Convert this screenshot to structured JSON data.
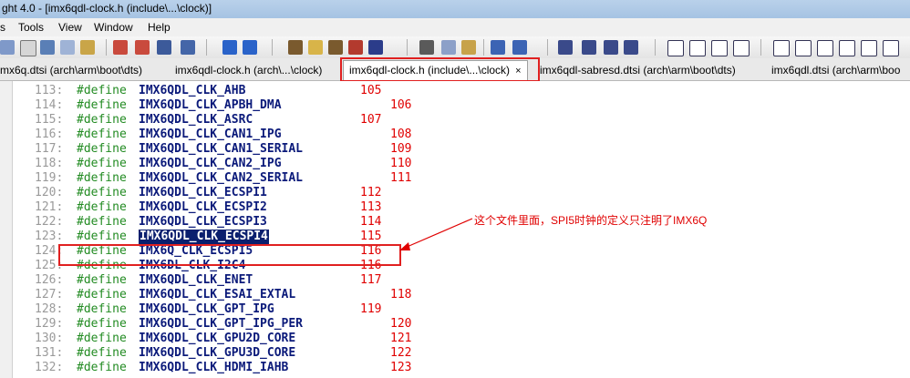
{
  "window": {
    "title": "ght 4.0 - [imx6qdl-clock.h (include\\...\\clock)]"
  },
  "menu": [
    "s",
    "Tools",
    "View",
    "Window",
    "Help"
  ],
  "tabs": [
    {
      "label": "mx6q.dtsi (arch\\arm\\boot\\dts)"
    },
    {
      "label": "imx6qdl-clock.h (arch\\...\\clock)"
    },
    {
      "label": "imx6qdl-clock.h (include\\...\\clock)",
      "close": "×"
    },
    {
      "label": "imx6qdl-sabresd.dtsi (arch\\arm\\boot\\dts)"
    },
    {
      "label": "imx6qdl.dtsi (arch\\arm\\boo"
    }
  ],
  "code": {
    "keyword": "#define",
    "lines": [
      {
        "num": "113:",
        "name": "IMX6QDL_CLK_AHB",
        "value": "105"
      },
      {
        "num": "114:",
        "name": "IMX6QDL_CLK_APBH_DMA",
        "value": "106"
      },
      {
        "num": "115:",
        "name": "IMX6QDL_CLK_ASRC",
        "value": "107"
      },
      {
        "num": "116:",
        "name": "IMX6QDL_CLK_CAN1_IPG",
        "value": "108"
      },
      {
        "num": "117:",
        "name": "IMX6QDL_CLK_CAN1_SERIAL",
        "value": "109"
      },
      {
        "num": "118:",
        "name": "IMX6QDL_CLK_CAN2_IPG",
        "value": "110"
      },
      {
        "num": "119:",
        "name": "IMX6QDL_CLK_CAN2_SERIAL",
        "value": "111"
      },
      {
        "num": "120:",
        "name": "IMX6QDL_CLK_ECSPI1",
        "value": "112"
      },
      {
        "num": "121:",
        "name": "IMX6QDL_CLK_ECSPI2",
        "value": "113"
      },
      {
        "num": "122:",
        "name": "IMX6QDL_CLK_ECSPI3",
        "value": "114"
      },
      {
        "num": "123:",
        "name": "IMX6QDL_CLK_ECSPI4",
        "value": "115"
      },
      {
        "num": "124:",
        "name": "IMX6Q_CLK_ECSPI5",
        "value": "116"
      },
      {
        "num": "125:",
        "name": "IMX6DL_CLK_I2C4",
        "value": "116"
      },
      {
        "num": "126:",
        "name": "IMX6QDL_CLK_ENET",
        "value": "117"
      },
      {
        "num": "127:",
        "name": "IMX6QDL_CLK_ESAI_EXTAL",
        "value": "118"
      },
      {
        "num": "128:",
        "name": "IMX6QDL_CLK_GPT_IPG",
        "value": "119"
      },
      {
        "num": "129:",
        "name": "IMX6QDL_CLK_GPT_IPG_PER",
        "value": "120"
      },
      {
        "num": "130:",
        "name": "IMX6QDL_CLK_GPU2D_CORE",
        "value": "121"
      },
      {
        "num": "131:",
        "name": "IMX6QDL_CLK_GPU3D_CORE",
        "value": "122"
      },
      {
        "num": "132:",
        "name": "IMX6QDL_CLK_HDMI_IAHB",
        "value": "123"
      }
    ]
  },
  "annotation": "这个文件里面，SPI5时钟的定义只注明了IMX6Q",
  "colors": {
    "keyword": "#228b22",
    "macro": "#0b1a7a",
    "value": "#e00000",
    "selection": "#0a1f6e",
    "annotation": "#e00000"
  }
}
